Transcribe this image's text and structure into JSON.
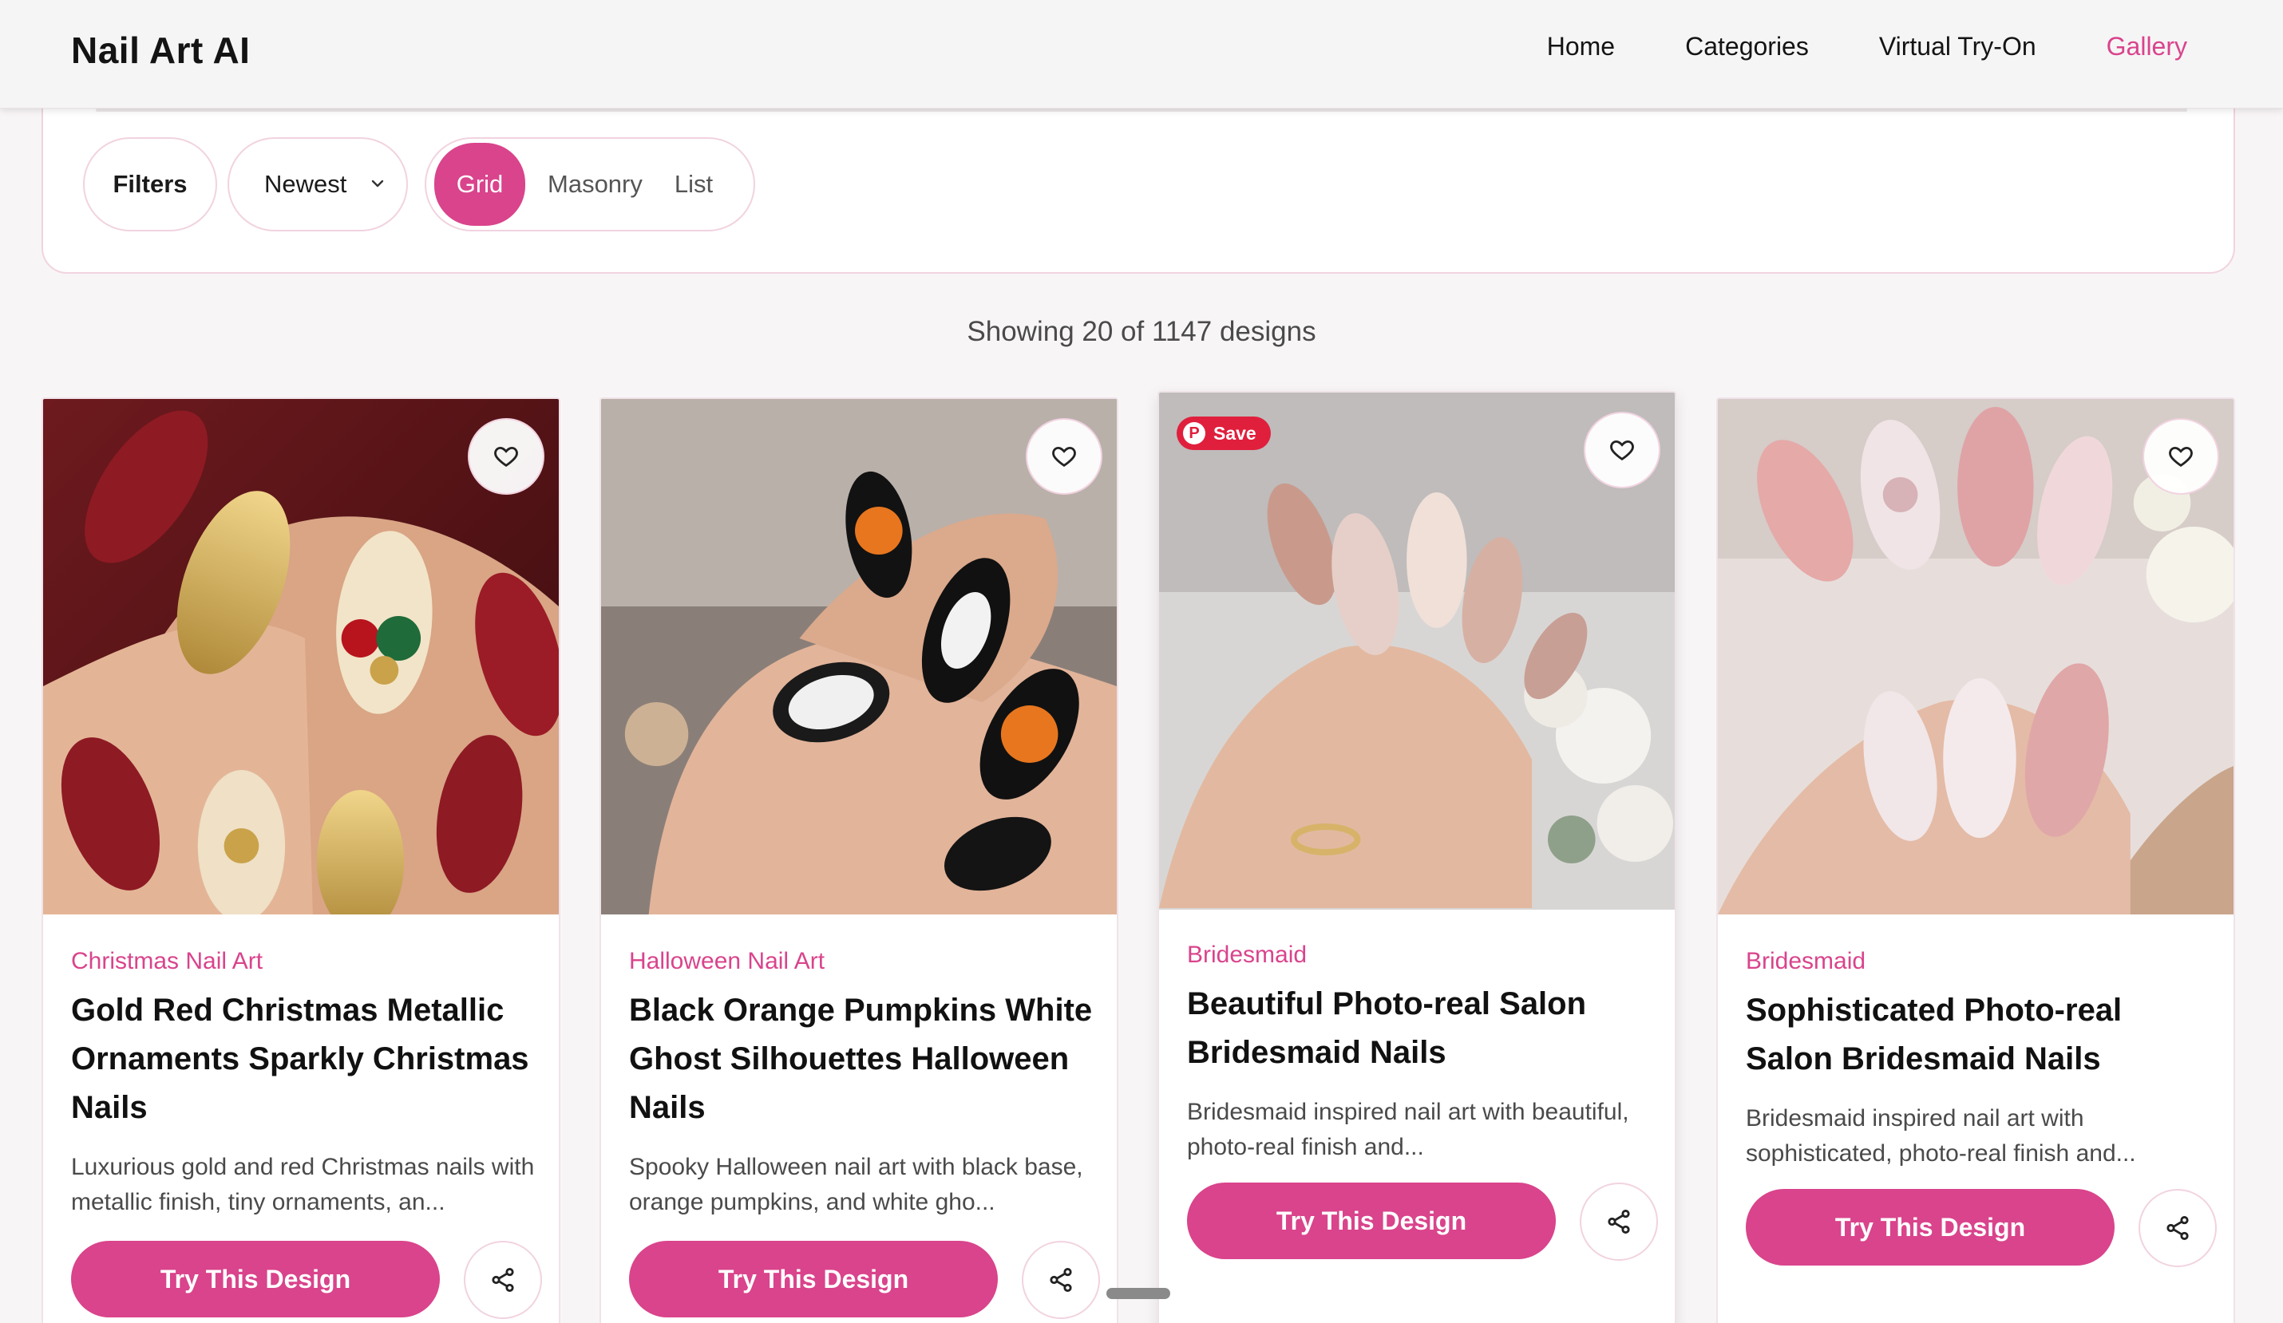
{
  "header": {
    "brand": "Nail Art AI",
    "nav": [
      "Home",
      "Categories",
      "Virtual Try-On",
      "Gallery"
    ],
    "active_nav": "Gallery"
  },
  "toolbar": {
    "filters_label": "Filters",
    "sort_value": "Newest",
    "view_options": [
      "Grid",
      "Masonry",
      "List"
    ],
    "active_view": "Grid"
  },
  "results": {
    "count_text": "Showing 20 of 1147 designs"
  },
  "cards": [
    {
      "category": "Christmas Nail Art",
      "title": "Gold Red Christmas Metallic Ornaments Sparkly Christmas Nails",
      "description": "Luxurious gold and red Christmas nails with metallic finish, tiny ornaments, an...",
      "button": "Try This Design"
    },
    {
      "category": "Halloween Nail Art",
      "title": "Black Orange Pumpkins White Ghost Silhouettes Halloween Nails",
      "description": "Spooky Halloween nail art with black base, orange pumpkins, and white gho...",
      "button": "Try This Design"
    },
    {
      "category": "Bridesmaid",
      "title": "Beautiful Photo-real Salon Bridesmaid Nails",
      "description": "Bridesmaid inspired nail art with beautiful, photo-real finish and...",
      "button": "Try This Design",
      "save_badge": "Save"
    },
    {
      "category": "Bridesmaid",
      "title": "Sophisticated Photo-real Salon Bridesmaid Nails",
      "description": "Bridesmaid inspired nail art with sophisticated, photo-real finish and...",
      "button": "Try This Design"
    }
  ],
  "colors": {
    "accent": "#d9448c",
    "pinterest": "#e01f3d",
    "background": "#f8f5f6"
  }
}
